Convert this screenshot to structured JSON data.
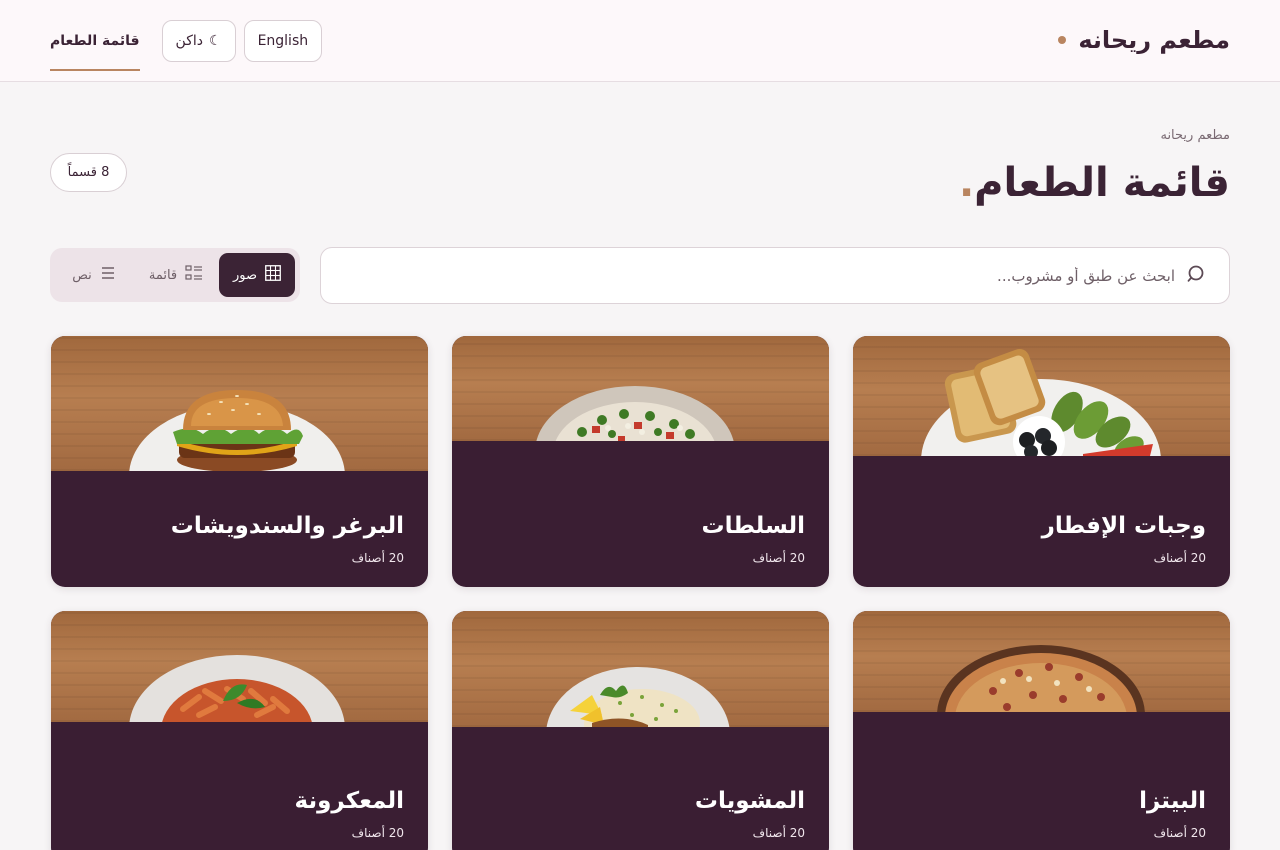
{
  "header": {
    "brand": "مطعم ريحانه",
    "nav_tab": "قائمة الطعام",
    "theme_label": "داكن",
    "theme_icon": "☾",
    "lang_label": "English"
  },
  "page": {
    "breadcrumb": "مطعم ريحانه",
    "title": "قائمة الطعام",
    "title_dot": ".",
    "count_badge": "8 قسماً"
  },
  "search": {
    "placeholder": "ابحث عن طبق أو مشروب..."
  },
  "view_toggle": {
    "options": [
      {
        "label": "صور",
        "icon": "grid-icon",
        "active": true
      },
      {
        "label": "قائمة",
        "icon": "list-detail-icon",
        "active": false
      },
      {
        "label": "نص",
        "icon": "text-lines-icon",
        "active": false
      }
    ]
  },
  "categories": [
    {
      "title": "وجبات الإفطار",
      "count": "20 أصناف",
      "photo": "breakfast-plate"
    },
    {
      "title": "السلطات",
      "count": "20 أصناف",
      "photo": "salad-bowl"
    },
    {
      "title": "البرغر والسندويشات",
      "count": "20 أصناف",
      "photo": "burger"
    },
    {
      "title": "البيتزا",
      "count": "20 أصناف",
      "photo": "pizza"
    },
    {
      "title": "المشويات",
      "count": "20 أصناف",
      "photo": "grill-rice-plate"
    },
    {
      "title": "المعكرونة",
      "count": "20 أصناف",
      "photo": "pasta-plate"
    }
  ],
  "colors": {
    "primary": "#3b2335",
    "accent": "#b98560",
    "card_bg": "#3a1e33",
    "page_bg": "#f7f5f6"
  }
}
